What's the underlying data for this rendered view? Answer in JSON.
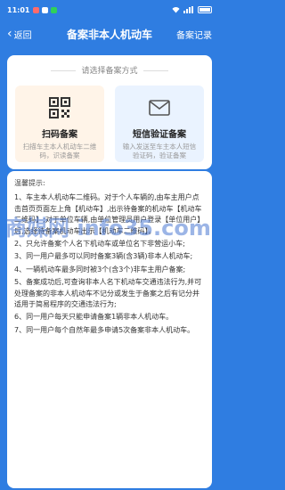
{
  "status": {
    "time": "11:01",
    "battery": "86"
  },
  "header": {
    "back": "返回",
    "title": "备案非本人机动车",
    "records": "备案记录"
  },
  "method": {
    "title": "请选择备案方式",
    "options": [
      {
        "label": "扫码备案",
        "desc": "扫描车主本人机动车二维码，识读备案",
        "icon": "qr-code-icon"
      },
      {
        "label": "短信验证备案",
        "desc": "输入发送至车主本人短信验证码，验证备案",
        "icon": "envelope-icon"
      }
    ]
  },
  "tips": {
    "heading": "温馨提示:",
    "items": [
      "1、车主本人机动车二维码。对于个人车辆的,由车主用户点击首页页面左上角【机动车】,出示待备案的机动车【机动车二维码】;对于单位车辆,由单位管理员用户登录【单位用户】后,选择待备案机动车出示【机动车二维码】。",
      "2、只允许备案个人名下机动车或单位名下非营运小车;",
      "3、同一用户最多可以同时备案3辆(含3辆)非本人机动车;",
      "4、一辆机动车最多同时被3个(含3个)非车主用户备案;",
      "5、备案成功后,可查询非本人名下机动车交通违法行为,并可处理备案的非本人机动车不记分或发生于备案之后有记分并适用于简易程序的交通违法行为;",
      "6、同一用户每天只能申请备案1辆非本人机动车。",
      "7、同一用户每个自然年最多申请5次备案非本人机动车。"
    ]
  },
  "watermark": "商媒网 info35.com",
  "colors": {
    "primary": "#2f7de1",
    "scan_bg": "#fff4e8",
    "sms_bg": "#eaf3ff"
  }
}
